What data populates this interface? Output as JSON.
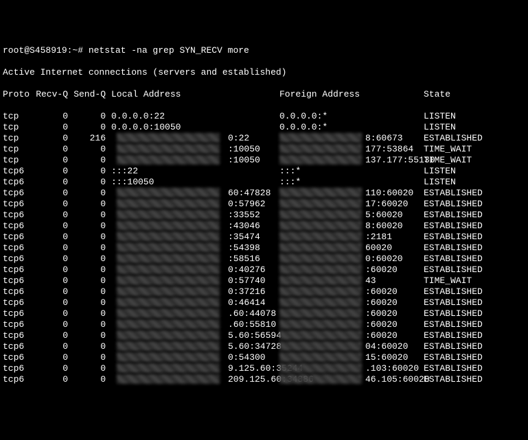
{
  "prompt": "root@S458919:~# netstat -na grep SYN_RECV more",
  "title": "Active Internet connections (servers and established)",
  "headers": {
    "proto": "Proto",
    "recvq": "Recv-Q",
    "sendq": "Send-Q",
    "local": "Local Address",
    "foreign": "Foreign Address",
    "state": "State"
  },
  "rows": [
    {
      "proto": "tcp",
      "recvq": "0",
      "sendq": "0",
      "local": "0.0.0.0:22",
      "foreign": "0.0.0.0:*",
      "state": "LISTEN",
      "masked": false
    },
    {
      "proto": "tcp",
      "recvq": "0",
      "sendq": "0",
      "local": "0.0.0.0:10050",
      "foreign": "0.0.0.0:*",
      "state": "LISTEN",
      "masked": false
    },
    {
      "proto": "tcp",
      "recvq": "0",
      "sendq": "216",
      "lport": "0:22",
      "fport": "8:60673",
      "state": "ESTABLISHED",
      "masked": true
    },
    {
      "proto": "tcp",
      "recvq": "0",
      "sendq": "0",
      "lport": ":10050",
      "fport": "177:53864",
      "state": "TIME_WAIT",
      "masked": true
    },
    {
      "proto": "tcp",
      "recvq": "0",
      "sendq": "0",
      "lport": ":10050",
      "fport": "137.177:55130",
      "state": "TIME_WAIT",
      "masked": true
    },
    {
      "proto": "tcp6",
      "recvq": "0",
      "sendq": "0",
      "local": ":::22",
      "foreign": ":::*",
      "state": "LISTEN",
      "masked": false
    },
    {
      "proto": "tcp6",
      "recvq": "0",
      "sendq": "0",
      "local": ":::10050",
      "foreign": ":::*",
      "state": "LISTEN",
      "masked": false
    },
    {
      "proto": "tcp6",
      "recvq": "0",
      "sendq": "0",
      "lport": "60:47828",
      "fport": "110:60020",
      "state": "ESTABLISHED",
      "masked": true
    },
    {
      "proto": "tcp6",
      "recvq": "0",
      "sendq": "0",
      "lport": "0:57962",
      "fport": "17:60020",
      "state": "ESTABLISHED",
      "masked": true
    },
    {
      "proto": "tcp6",
      "recvq": "0",
      "sendq": "0",
      "lport": ":33552",
      "fport": "5:60020",
      "state": "ESTABLISHED",
      "masked": true
    },
    {
      "proto": "tcp6",
      "recvq": "0",
      "sendq": "0",
      "lport": ":43046",
      "fport": "8:60020",
      "state": "ESTABLISHED",
      "masked": true
    },
    {
      "proto": "tcp6",
      "recvq": "0",
      "sendq": "0",
      "lport": ":35474",
      "fport": ":2181",
      "state": "ESTABLISHED",
      "masked": true
    },
    {
      "proto": "tcp6",
      "recvq": "0",
      "sendq": "0",
      "lport": ":54398",
      "fport": "60020",
      "state": "ESTABLISHED",
      "masked": true
    },
    {
      "proto": "tcp6",
      "recvq": "0",
      "sendq": "0",
      "lport": ":58516",
      "fport": "0:60020",
      "state": "ESTABLISHED",
      "masked": true
    },
    {
      "proto": "tcp6",
      "recvq": "0",
      "sendq": "0",
      "lport": "0:40276",
      "fport": ":60020",
      "state": "ESTABLISHED",
      "masked": true
    },
    {
      "proto": "tcp6",
      "recvq": "0",
      "sendq": "0",
      "lport": "0:57740",
      "fport": "43",
      "state": "TIME_WAIT",
      "masked": true
    },
    {
      "proto": "tcp6",
      "recvq": "0",
      "sendq": "0",
      "lport": "0:37216",
      "fport": ":60020",
      "state": "ESTABLISHED",
      "masked": true
    },
    {
      "proto": "tcp6",
      "recvq": "0",
      "sendq": "0",
      "lport": "0:46414",
      "fport": ":60020",
      "state": "ESTABLISHED",
      "masked": true
    },
    {
      "proto": "tcp6",
      "recvq": "0",
      "sendq": "0",
      "lport": ".60:44078",
      "fport": ":60020",
      "state": "ESTABLISHED",
      "masked": true
    },
    {
      "proto": "tcp6",
      "recvq": "0",
      "sendq": "0",
      "lport": ".60:55810",
      "fport": ":60020",
      "state": "ESTABLISHED",
      "masked": true
    },
    {
      "proto": "tcp6",
      "recvq": "0",
      "sendq": "0",
      "lport": "5.60:56594",
      "fport": ":60020",
      "state": "ESTABLISHED",
      "masked": true
    },
    {
      "proto": "tcp6",
      "recvq": "0",
      "sendq": "0",
      "lport": "5.60:34728",
      "fport": "04:60020",
      "state": "ESTABLISHED",
      "masked": true
    },
    {
      "proto": "tcp6",
      "recvq": "0",
      "sendq": "0",
      "lport": "0:54300",
      "fport": "15:60020",
      "state": "ESTABLISHED",
      "masked": true
    },
    {
      "proto": "tcp6",
      "recvq": "0",
      "sendq": "0",
      "lport": "9.125.60:35244",
      "fport": ".103:60020",
      "state": "ESTABLISHED",
      "masked": true
    },
    {
      "proto": "tcp6",
      "recvq": "0",
      "sendq": "0",
      "lport": "209.125.60:34886",
      "fport": "46.105:60020",
      "state": "ESTABLISHED",
      "masked": true
    }
  ]
}
